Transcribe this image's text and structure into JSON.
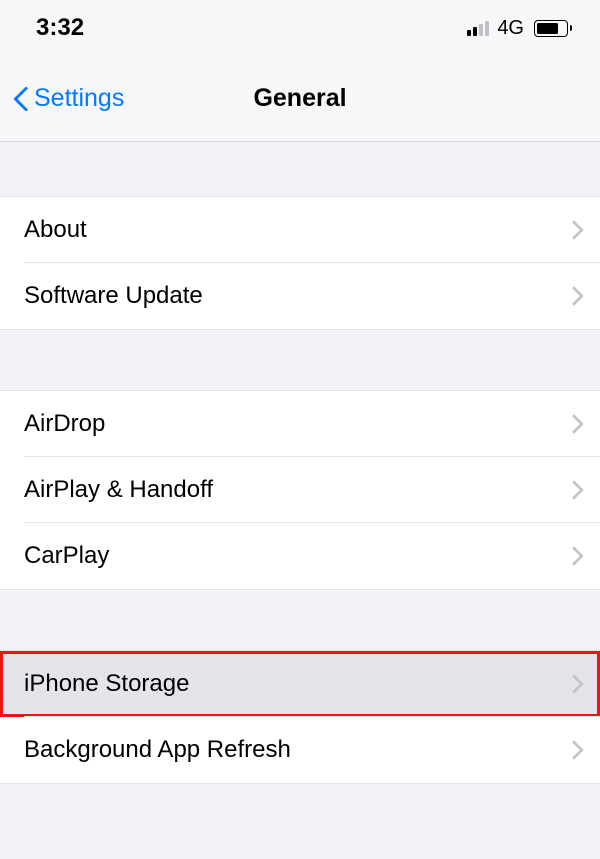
{
  "statusBar": {
    "time": "3:32",
    "network": "4G"
  },
  "navBar": {
    "backLabel": "Settings",
    "title": "General"
  },
  "groups": [
    {
      "items": [
        {
          "label": "About"
        },
        {
          "label": "Software Update"
        }
      ]
    },
    {
      "items": [
        {
          "label": "AirDrop"
        },
        {
          "label": "AirPlay & Handoff"
        },
        {
          "label": "CarPlay"
        }
      ]
    },
    {
      "items": [
        {
          "label": "iPhone Storage"
        },
        {
          "label": "Background App Refresh"
        }
      ]
    }
  ]
}
